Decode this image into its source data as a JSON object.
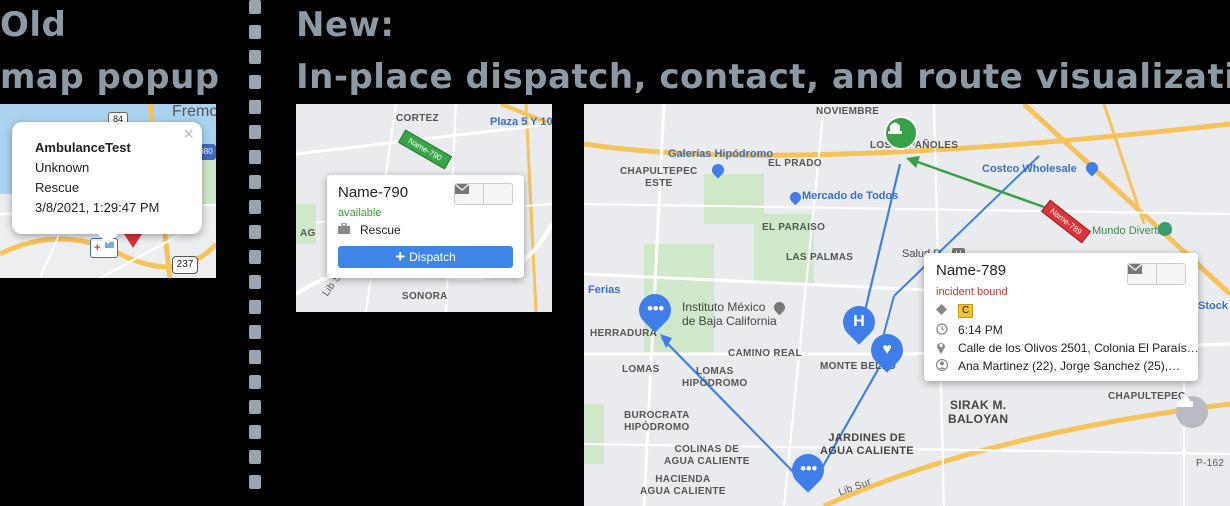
{
  "left_heading": {
    "line1": "Old",
    "line2": "map popup"
  },
  "right_heading": {
    "line1": "New:",
    "line2": "In-place dispatch, contact, and route visualization"
  },
  "old_map": {
    "labels": {
      "fremont": "Fremo",
      "route237": "237",
      "route84": "84",
      "route880": "880"
    },
    "popup": {
      "name": "AmbulanceTest",
      "status": "Unknown",
      "type": "Rescue",
      "timestamp": "3/8/2021, 1:29:47 PM",
      "close": "×"
    }
  },
  "small_map": {
    "labels": {
      "cortez": "CORTEZ",
      "plaza": "Plaza 5 Y 10",
      "sonora": "SONORA",
      "lib_sur": "Lib Sur",
      "ag": "AG"
    },
    "vehicle_label": "Name-790",
    "card": {
      "name": "Name-790",
      "status": "available",
      "type": "Rescue",
      "dispatch_label": "Dispatch"
    }
  },
  "big_map": {
    "labels": {
      "november": "NOVIEMBRE",
      "los_espanoles": "LOS ESPAÑOLES",
      "costco": "Costco Wholesale",
      "mundo": "Mundo Divertido",
      "galerias": "Galerías Hipódromo",
      "chapultepec_este": "CHAPULTEPEC\nESTE",
      "el_prado": "EL PRADO",
      "mercado": "Mercado de Todos",
      "el_paraiso": "EL PARAISO",
      "las_palmas": "LAS PALMAS",
      "salud": "Salud D",
      "ferias": "Ferias",
      "herradura": "HERRADURA",
      "instituto": "Instituto México\nde Baja California",
      "stock": "Stock",
      "camino_real": "CAMINO REAL",
      "lomas_hipodromo": "LOMAS\nHIPÓDROMO",
      "lomas": "LOMAS",
      "monte_bello": "MONTE BELLO",
      "chapultepec": "CHAPULTEPEC",
      "sirak": "SIRAK M.\nBALOYAN",
      "burocrata": "BUROCRATA\nHIPÓDROMO",
      "colinas": "COLINAS DE\nAGUA CALIENTE",
      "jardines": "JARDINES DE\nAGUA CALIENTE",
      "hacienda": "HACIENDA\nAGUA CALIENTE",
      "lib_sur": "Lib Sur",
      "p162": "P-162"
    },
    "vehicle_label": "Name-789",
    "card": {
      "name": "Name-789",
      "status": "incident bound",
      "priority": "C",
      "time": "6:14 PM",
      "address": "Calle de los Olivos 2501, Colonia El Paraís…",
      "patients": "Ana Martinez (22), Jorge Sanchez (25),…"
    }
  },
  "colors": {
    "blue": "#3f7ee8",
    "green": "#38a047",
    "red": "#d8343a",
    "status_green": "#3a9d3a",
    "status_red": "#d0342c",
    "dispatch_blue": "#3d85e6",
    "priority_yellow": "#f2c230",
    "heading_gray": "#8c9aa6"
  }
}
